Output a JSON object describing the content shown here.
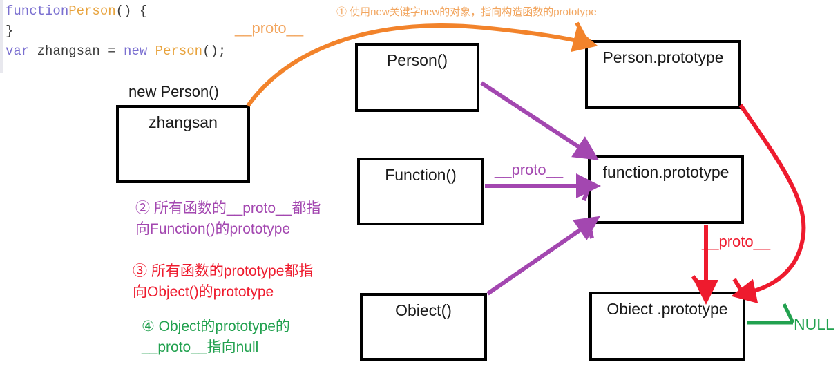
{
  "code": {
    "line1_kw": "function",
    "line1_name": "Person",
    "line1_tail": "() {",
    "line2": "}",
    "line3_kw1": "var",
    "line3_var": " zhangsan = ",
    "line3_kw2": "new",
    "line3_name": " Person",
    "line3_tail": "();"
  },
  "colors": {
    "orange": "#f2832b",
    "purple": "#a347b0",
    "red": "#ee1b2e",
    "green": "#22a14f",
    "black": "#000000",
    "code_keyword": "#7a6fd0",
    "code_function_name": "#e8a33d",
    "code_plain": "#3b3b3b"
  },
  "boxes": {
    "zhangsan": {
      "label": "zhangsan",
      "outside_label": "new Person()"
    },
    "person_ctor": {
      "label": "Person()"
    },
    "function_ctor": {
      "label": "Function()"
    },
    "object_ctor": {
      "label": "Obiect()"
    },
    "person_prototype": {
      "label": "Person.prototype"
    },
    "function_prototype": {
      "label": "function.prototype"
    },
    "object_prototype": {
      "label": "Obiect .prototype"
    }
  },
  "arrow_labels": {
    "proto_orange": "__proto__",
    "proto_purple": "__proto__",
    "proto_red": "__proto__",
    "null": "NULL"
  },
  "annotations": {
    "note1": "① 使用new关键字new的对象，指向构造函数的prototype",
    "note2": "② 所有函数的__proto__都指\n向Function()的prototype",
    "note3": "③ 所有函数的prototype都指\n向Object()的prototype",
    "note4": "④ Object的prototype的\n__proto__指向null"
  }
}
